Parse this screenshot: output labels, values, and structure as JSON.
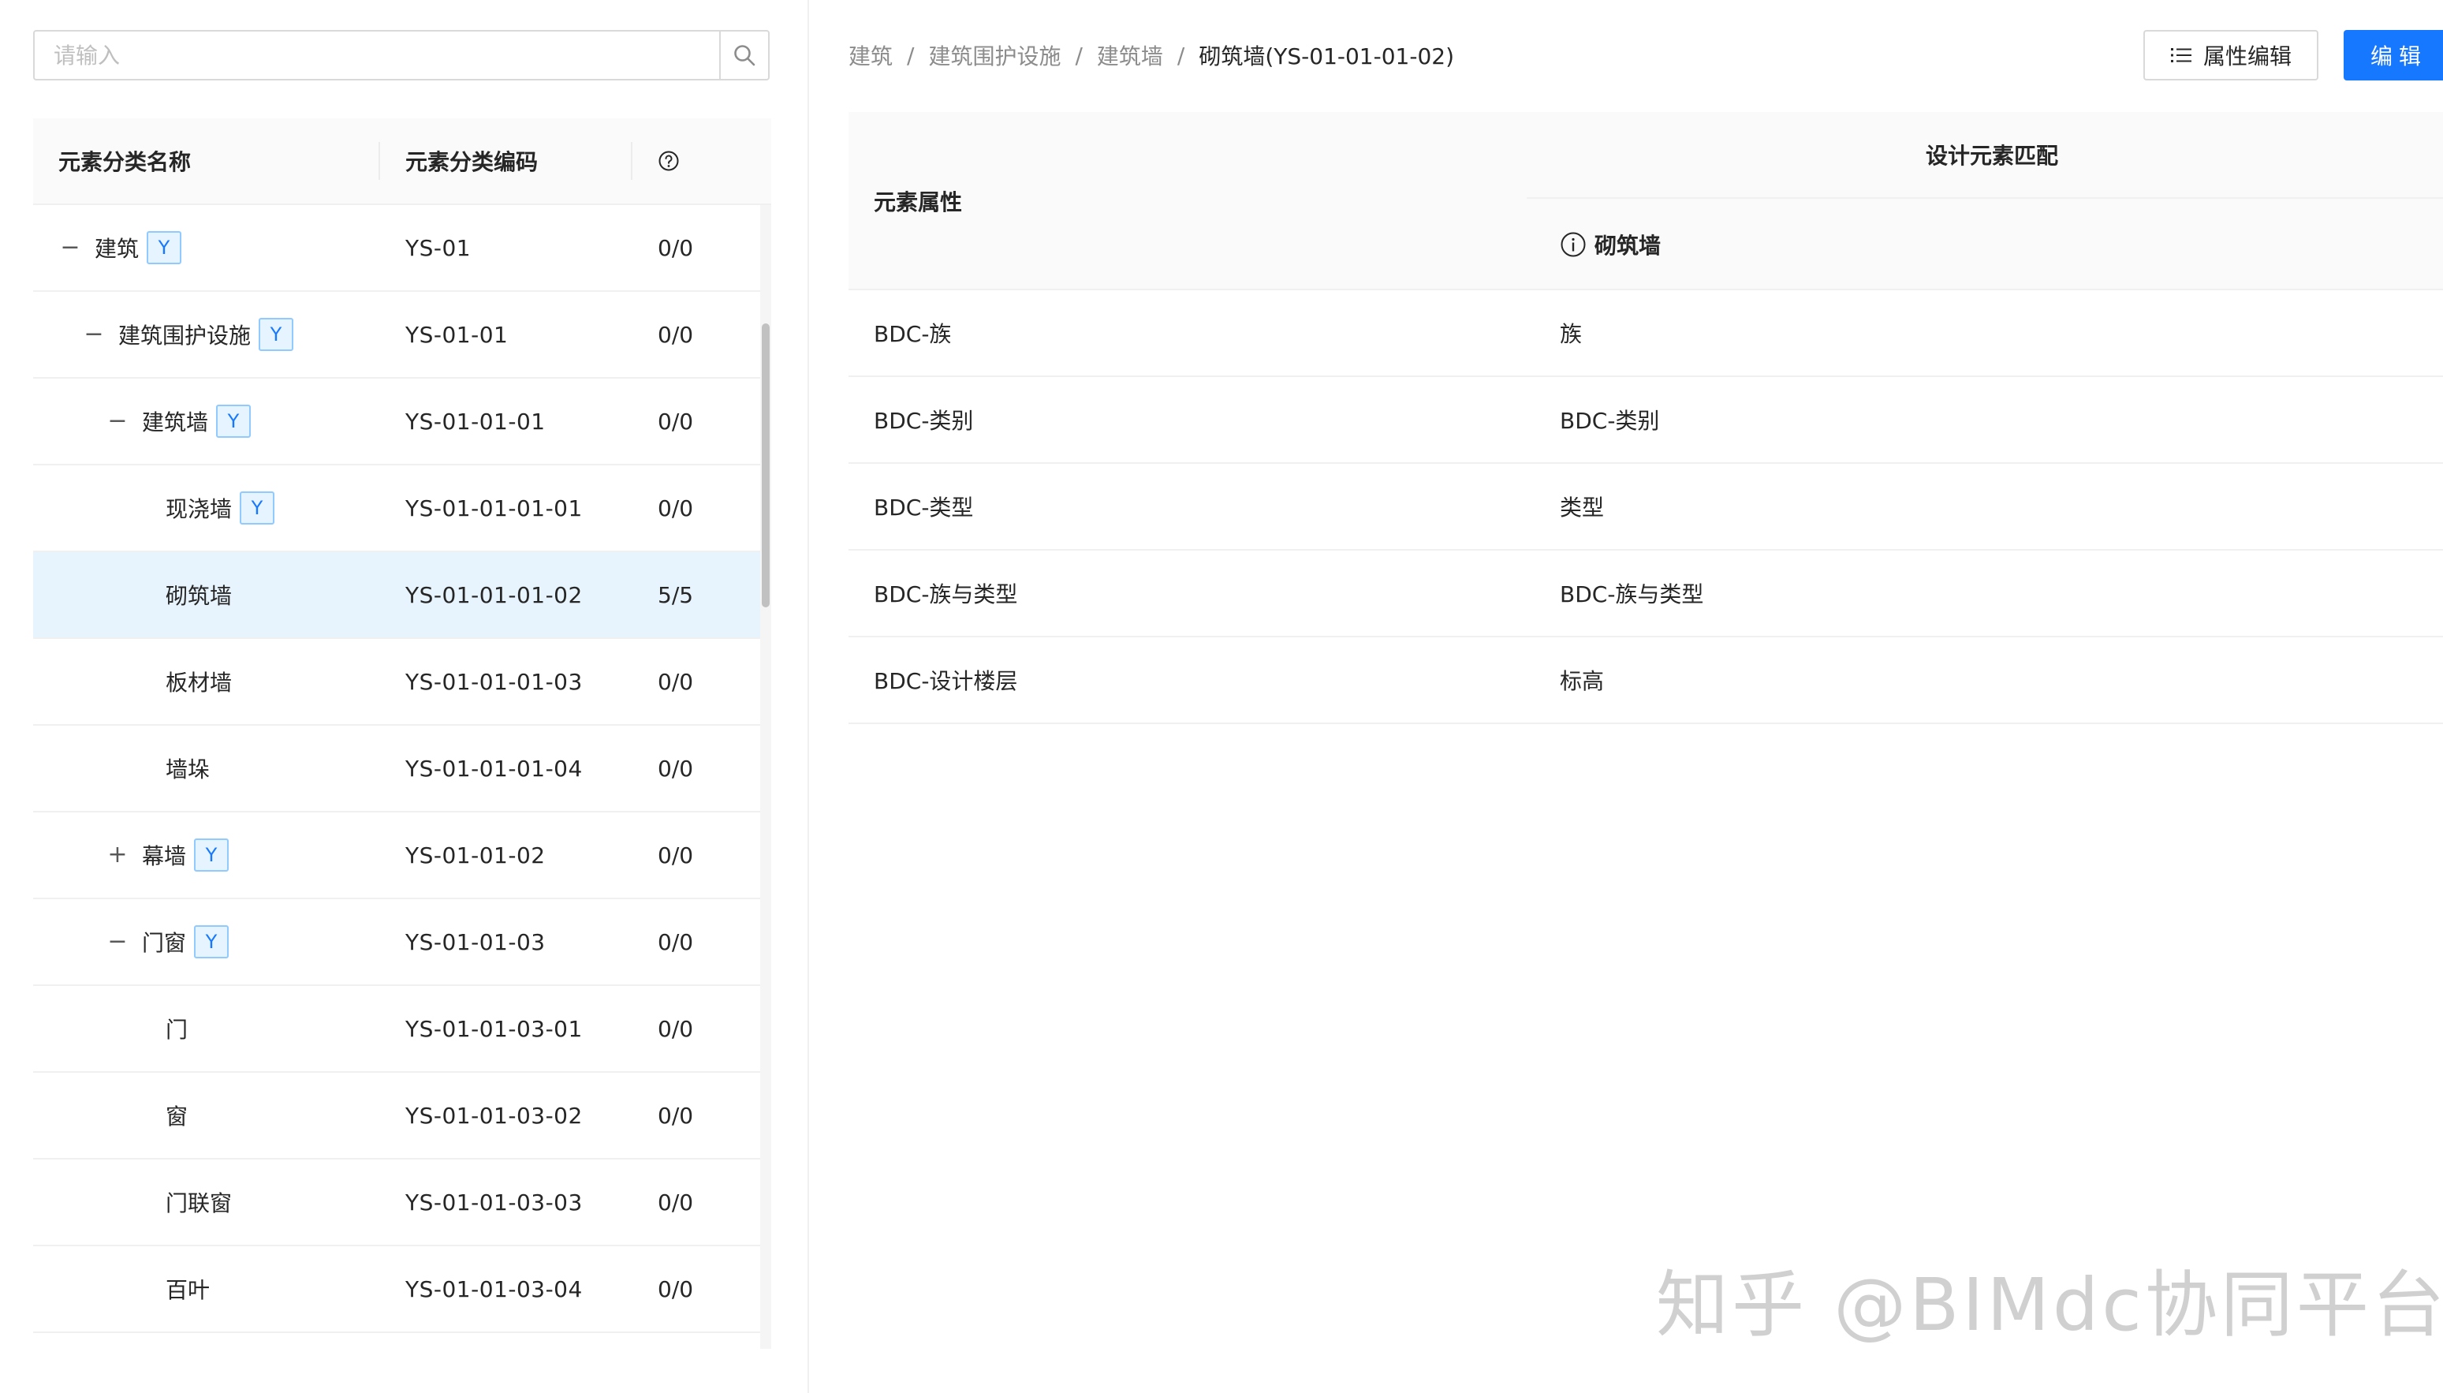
{
  "search": {
    "placeholder": "请输入"
  },
  "tree": {
    "columns": {
      "name": "元素分类名称",
      "code": "元素分类编码"
    },
    "rows": [
      {
        "name": "建筑",
        "code": "YS-01",
        "count": "0/0",
        "level": 0,
        "toggle": "−",
        "tag": "Y"
      },
      {
        "name": "建筑围护设施",
        "code": "YS-01-01",
        "count": "0/0",
        "level": 1,
        "toggle": "−",
        "tag": "Y"
      },
      {
        "name": "建筑墙",
        "code": "YS-01-01-01",
        "count": "0/0",
        "level": 2,
        "toggle": "−",
        "tag": "Y"
      },
      {
        "name": "现浇墙",
        "code": "YS-01-01-01-01",
        "count": "0/0",
        "level": 3,
        "toggle": "",
        "tag": "Y"
      },
      {
        "name": "砌筑墙",
        "code": "YS-01-01-01-02",
        "count": "5/5",
        "level": 3,
        "toggle": "",
        "tag": "",
        "selected": true
      },
      {
        "name": "板材墙",
        "code": "YS-01-01-01-03",
        "count": "0/0",
        "level": 3,
        "toggle": "",
        "tag": ""
      },
      {
        "name": "墙垛",
        "code": "YS-01-01-01-04",
        "count": "0/0",
        "level": 3,
        "toggle": "",
        "tag": ""
      },
      {
        "name": "幕墙",
        "code": "YS-01-01-02",
        "count": "0/0",
        "level": 2,
        "toggle": "+",
        "tag": "Y"
      },
      {
        "name": "门窗",
        "code": "YS-01-01-03",
        "count": "0/0",
        "level": 2,
        "toggle": "−",
        "tag": "Y"
      },
      {
        "name": "门",
        "code": "YS-01-01-03-01",
        "count": "0/0",
        "level": 3,
        "toggle": "",
        "tag": ""
      },
      {
        "name": "窗",
        "code": "YS-01-01-03-02",
        "count": "0/0",
        "level": 3,
        "toggle": "",
        "tag": ""
      },
      {
        "name": "门联窗",
        "code": "YS-01-01-03-03",
        "count": "0/0",
        "level": 3,
        "toggle": "",
        "tag": ""
      },
      {
        "name": "百叶",
        "code": "YS-01-01-03-04",
        "count": "0/0",
        "level": 3,
        "toggle": "",
        "tag": ""
      }
    ]
  },
  "breadcrumb": {
    "items": [
      "建筑",
      "建筑围护设施",
      "建筑墙"
    ],
    "separator": "/",
    "current": "砌筑墙(YS-01-01-01-02)"
  },
  "toolbar": {
    "attr_edit_label": "属性编辑",
    "edit_label": "编辑"
  },
  "attr_table": {
    "col_attr": "元素属性",
    "col_group": "设计元素匹配",
    "col_sub": "砌筑墙",
    "rows": [
      {
        "attr": "BDC-族",
        "match": "族"
      },
      {
        "attr": "BDC-类别",
        "match": "BDC-类别"
      },
      {
        "attr": "BDC-类型",
        "match": "类型"
      },
      {
        "attr": "BDC-族与类型",
        "match": "BDC-族与类型"
      },
      {
        "attr": "BDC-设计楼层",
        "match": "标高"
      }
    ]
  },
  "watermark": "知乎 @BIMdc协同平台",
  "colors": {
    "primary": "#1677ff",
    "selected_row": "#e8f4fd",
    "tag_border": "#91caff"
  }
}
